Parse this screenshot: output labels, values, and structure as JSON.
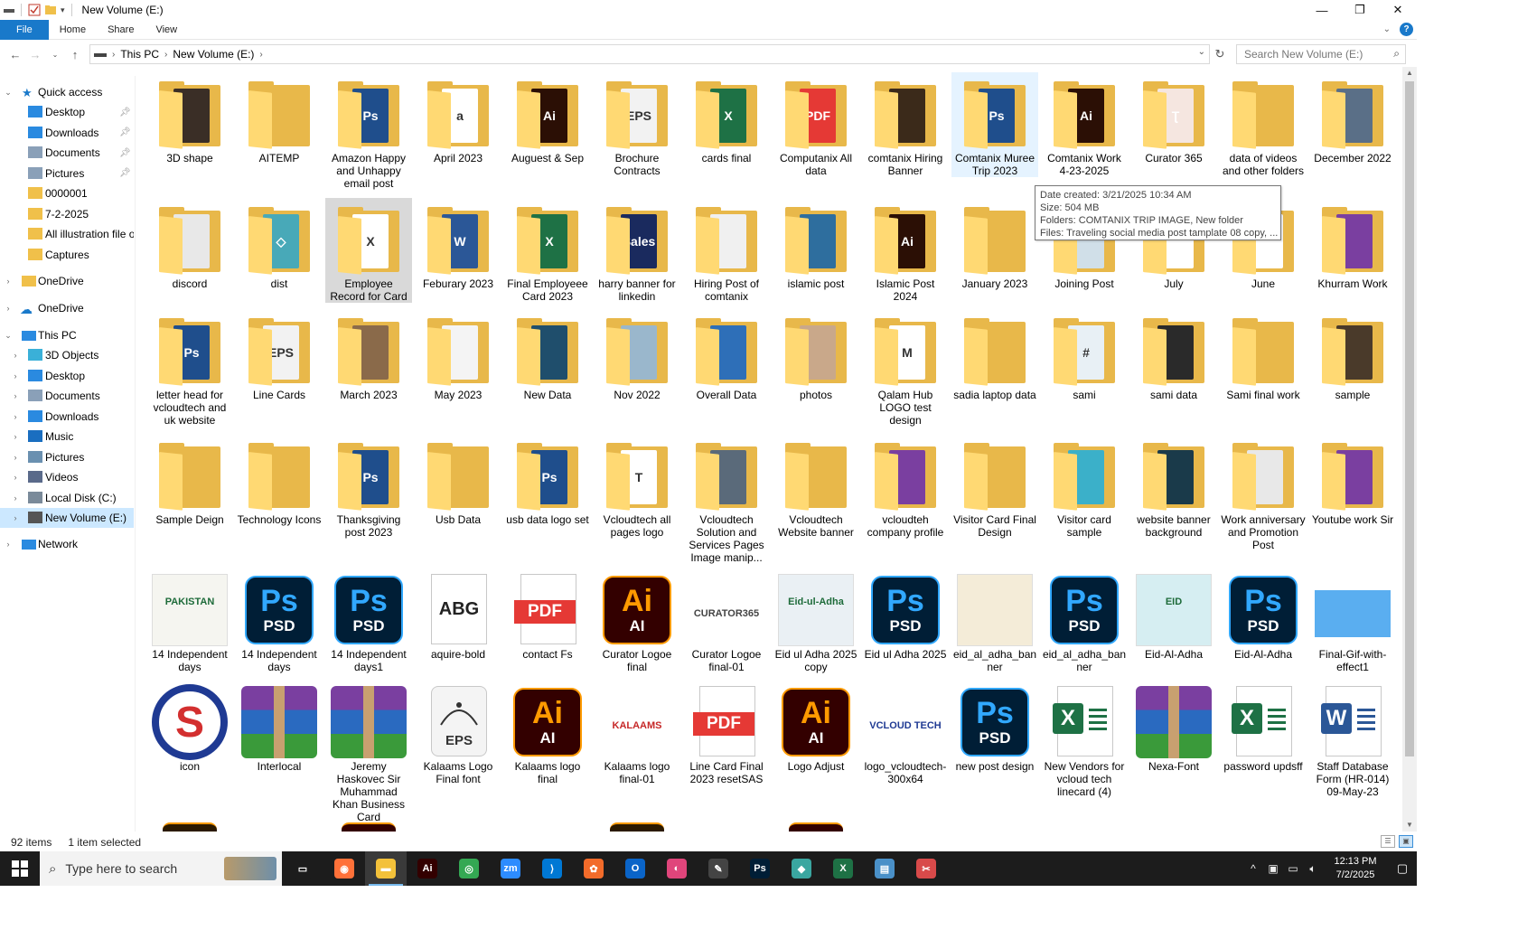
{
  "window": {
    "title": "New Volume (E:)",
    "controls": {
      "minimize": "—",
      "maximize": "❐",
      "close": "✕"
    }
  },
  "ribbon": {
    "tabs": [
      "File",
      "Home",
      "Share",
      "View"
    ],
    "help": "?"
  },
  "address": {
    "crumbs": [
      "This PC",
      "New Volume (E:)"
    ],
    "search_placeholder": "Search New Volume (E:)"
  },
  "sidebar": {
    "quick_access": "Quick access",
    "quick_items": [
      "Desktop",
      "Downloads",
      "Documents",
      "Pictures",
      "0000001",
      "7-2-2025",
      "All illustration file o",
      "Captures"
    ],
    "onedrive1": "OneDrive",
    "onedrive2": "OneDrive",
    "this_pc": "This PC",
    "pc_items": [
      "3D Objects",
      "Desktop",
      "Documents",
      "Downloads",
      "Music",
      "Pictures",
      "Videos",
      "Local Disk (C:)",
      "New Volume (E:)"
    ],
    "network": "Network"
  },
  "items": [
    {
      "label": "3D shape",
      "kind": "folder",
      "paper": "#3a2e26",
      "glyph": ""
    },
    {
      "label": "AITEMP",
      "kind": "folder",
      "paper": "",
      "glyph": ""
    },
    {
      "label": "Amazon Happy and Unhappy email post",
      "kind": "folder",
      "paper": "#1f4e8c",
      "glyph": "Ps"
    },
    {
      "label": "April 2023",
      "kind": "folder",
      "paper": "#ffffff",
      "glyph": "a"
    },
    {
      "label": "Auguest & Sep",
      "kind": "folder",
      "paper": "#2b0f05",
      "glyph": "Ai"
    },
    {
      "label": "Brochure Contracts",
      "kind": "folder",
      "paper": "#f2f2f2",
      "glyph": "EPS"
    },
    {
      "label": "cards final",
      "kind": "folder",
      "paper": "#1e7145",
      "glyph": "X"
    },
    {
      "label": "Computanix All data",
      "kind": "folder",
      "paper": "#e53935",
      "glyph": "PDF"
    },
    {
      "label": "comtanix Hiring Banner",
      "kind": "folder",
      "paper": "#3b2a1a",
      "glyph": ""
    },
    {
      "label": "Comtanix Muree Trip 2023",
      "kind": "folder",
      "paper": "#1f4e8c",
      "glyph": "Ps"
    },
    {
      "label": "Comtanix Work 4-23-2025",
      "kind": "folder",
      "paper": "#2b0f05",
      "glyph": "Ai"
    },
    {
      "label": "Curator 365",
      "kind": "folder",
      "paper": "#f5e6e0",
      "glyph": "Ʈ"
    },
    {
      "label": "data of videos and other folders",
      "kind": "folder",
      "paper": "",
      "glyph": ""
    },
    {
      "label": "December 2022",
      "kind": "folder",
      "paper": "#5a6f87",
      "glyph": ""
    },
    {
      "label": "discord",
      "kind": "folder",
      "paper": "#e8e8e8",
      "glyph": ""
    },
    {
      "label": "dist",
      "kind": "folder",
      "paper": "#48a9b8",
      "glyph": "◇"
    },
    {
      "label": "Employee Record for Card",
      "kind": "folder",
      "paper": "#ffffff",
      "glyph": "X"
    },
    {
      "label": "Feburary 2023",
      "kind": "folder",
      "paper": "#2b5797",
      "glyph": "W"
    },
    {
      "label": "Final  Employeee Card 2023",
      "kind": "folder",
      "paper": "#1e7145",
      "glyph": "X"
    },
    {
      "label": "harry banner for linkedin",
      "kind": "folder",
      "paper": "#1a2a5e",
      "glyph": "Sales"
    },
    {
      "label": "Hiring Post of comtanix",
      "kind": "folder",
      "paper": "#f0f0f0",
      "glyph": ""
    },
    {
      "label": "islamic post",
      "kind": "folder",
      "paper": "#2e6e9e",
      "glyph": ""
    },
    {
      "label": "Islamic Post 2024",
      "kind": "folder",
      "paper": "#2b0f05",
      "glyph": "Ai"
    },
    {
      "label": "January 2023",
      "kind": "folder",
      "paper": "",
      "glyph": ""
    },
    {
      "label": "Joining Post",
      "kind": "folder",
      "paper": "#d0dfe8",
      "glyph": ""
    },
    {
      "label": "July",
      "kind": "folder",
      "paper": "#ffffff",
      "glyph": ""
    },
    {
      "label": "June",
      "kind": "folder",
      "paper": "#ffffff",
      "glyph": ""
    },
    {
      "label": "Khurram Work",
      "kind": "folder",
      "paper": "#7a3fa0",
      "glyph": ""
    },
    {
      "label": "letter head for vcloudtech and uk website",
      "kind": "folder",
      "paper": "#1f4e8c",
      "glyph": "Ps"
    },
    {
      "label": "Line Cards",
      "kind": "folder",
      "paper": "#f2f2f2",
      "glyph": "EPS"
    },
    {
      "label": "March 2023",
      "kind": "folder",
      "paper": "#8a6a4a",
      "glyph": ""
    },
    {
      "label": "May 2023",
      "kind": "folder",
      "paper": "#f4f4f4",
      "glyph": ""
    },
    {
      "label": "New Data",
      "kind": "folder",
      "paper": "#1f4e6c",
      "glyph": ""
    },
    {
      "label": "Nov 2022",
      "kind": "folder",
      "paper": "#9ab7cc",
      "glyph": ""
    },
    {
      "label": "Overall Data",
      "kind": "folder",
      "paper": "#2e6fb8",
      "glyph": ""
    },
    {
      "label": "photos",
      "kind": "folder",
      "paper": "#c9a88a",
      "glyph": ""
    },
    {
      "label": "Qalam Hub LOGO test design",
      "kind": "folder",
      "paper": "#ffffff",
      "glyph": "M"
    },
    {
      "label": "sadia laptop data",
      "kind": "folder",
      "paper": "",
      "glyph": ""
    },
    {
      "label": "sami",
      "kind": "folder",
      "paper": "#e8f0f5",
      "glyph": "#"
    },
    {
      "label": "sami data",
      "kind": "folder",
      "paper": "#2a2a2a",
      "glyph": ""
    },
    {
      "label": "Sami final work",
      "kind": "folder",
      "paper": "",
      "glyph": ""
    },
    {
      "label": "sample",
      "kind": "folder",
      "paper": "#4a3a2a",
      "glyph": ""
    },
    {
      "label": "Sample Deign",
      "kind": "folder",
      "paper": "",
      "glyph": ""
    },
    {
      "label": "Technology Icons",
      "kind": "folder",
      "paper": "",
      "glyph": ""
    },
    {
      "label": "Thanksgiving post 2023",
      "kind": "folder",
      "paper": "#1f4e8c",
      "glyph": "Ps"
    },
    {
      "label": "Usb Data",
      "kind": "folder",
      "paper": "",
      "glyph": ""
    },
    {
      "label": "usb data logo set",
      "kind": "folder",
      "paper": "#1f4e8c",
      "glyph": "Ps"
    },
    {
      "label": "Vcloudtech all pages logo",
      "kind": "folder",
      "paper": "#ffffff",
      "glyph": "T"
    },
    {
      "label": "Vcloudtech Solution and Services Pages Image manip...",
      "kind": "folder",
      "paper": "#5a6a7a",
      "glyph": ""
    },
    {
      "label": "Vcloudtech Website banner",
      "kind": "folder",
      "paper": "",
      "glyph": ""
    },
    {
      "label": "vcloudteh company profile",
      "kind": "folder",
      "paper": "#7a3fa0",
      "glyph": ""
    },
    {
      "label": "Visitor Card Final Design",
      "kind": "folder",
      "paper": "",
      "glyph": ""
    },
    {
      "label": "Visitor card sample",
      "kind": "folder",
      "paper": "#3bb0c9",
      "glyph": ""
    },
    {
      "label": "website banner background",
      "kind": "folder",
      "paper": "#1a3a4a",
      "glyph": ""
    },
    {
      "label": "Work anniversary and Promotion  Post",
      "kind": "folder",
      "paper": "#e8e8e8",
      "glyph": ""
    },
    {
      "label": "Youtube work Sir",
      "kind": "folder",
      "paper": "#7a3fa0",
      "glyph": ""
    },
    {
      "label": "14 Independent days",
      "kind": "image",
      "color": "#f5f5f0",
      "glyph": "PAKISTAN"
    },
    {
      "label": "14 Independent days",
      "kind": "ps",
      "glyph": "Ps",
      "sub": "PSD"
    },
    {
      "label": "14 Independent days1",
      "kind": "ps",
      "glyph": "Ps",
      "sub": "PSD"
    },
    {
      "label": "aquire-bold",
      "kind": "font",
      "glyph": "ABG"
    },
    {
      "label": "contact Fs",
      "kind": "pdf",
      "glyph": "PDF"
    },
    {
      "label": "Curator Logoe final",
      "kind": "ai",
      "glyph": "Ai",
      "sub": "AI"
    },
    {
      "label": "Curator Logoe final-01",
      "kind": "logo",
      "glyph": "CURATOR365",
      "color": "#444444"
    },
    {
      "label": "Eid ul Adha 2025 copy",
      "kind": "image",
      "color": "#eaf0f4",
      "glyph": "Eid-ul-Adha"
    },
    {
      "label": "Eid ul Adha 2025",
      "kind": "ps",
      "glyph": "Ps",
      "sub": "PSD"
    },
    {
      "label": "eid_al_adha_banner",
      "kind": "image",
      "color": "#f4ecd8",
      "glyph": ""
    },
    {
      "label": "eid_al_adha_banner",
      "kind": "ps",
      "glyph": "Ps",
      "sub": "PSD"
    },
    {
      "label": "Eid-Al-Adha",
      "kind": "image",
      "color": "#d6eef2",
      "glyph": "EID"
    },
    {
      "label": "Eid-Al-Adha",
      "kind": "ps",
      "glyph": "Ps",
      "sub": "PSD"
    },
    {
      "label": "Final-Gif-with-effect1",
      "kind": "gif",
      "color": "#5aaef0",
      "glyph": ""
    },
    {
      "label": "icon",
      "kind": "logoS",
      "glyph": "S"
    },
    {
      "label": "Interlocal",
      "kind": "rar",
      "glyph": ""
    },
    {
      "label": "Jeremy Haskovec Sir Muhammad Khan Business Card",
      "kind": "rar",
      "glyph": ""
    },
    {
      "label": "Kalaams Logo Final font",
      "kind": "eps",
      "glyph": "EPS"
    },
    {
      "label": "Kalaams logo final",
      "kind": "ai",
      "glyph": "Ai",
      "sub": "AI"
    },
    {
      "label": "Kalaams logo final-01",
      "kind": "logo",
      "glyph": "KALAAMS",
      "color": "#c62828"
    },
    {
      "label": "Line Card Final 2023 resetSAS",
      "kind": "pdf",
      "glyph": "PDF"
    },
    {
      "label": "Logo Adjust",
      "kind": "ai",
      "glyph": "Ai",
      "sub": "AI"
    },
    {
      "label": "logo_vcloudtech-300x64",
      "kind": "logo",
      "glyph": "VCLOUD TECH",
      "color": "#1f3a93"
    },
    {
      "label": "new post design",
      "kind": "ps",
      "glyph": "Ps",
      "sub": "PSD"
    },
    {
      "label": "New Vendors for vcloud tech linecard (4)",
      "kind": "xls",
      "glyph": "X"
    },
    {
      "label": "Nexa-Font",
      "kind": "rar",
      "glyph": ""
    },
    {
      "label": "password updsff",
      "kind": "xls",
      "glyph": "X"
    },
    {
      "label": "Staff Database Form (HR-014) 09-May-23",
      "kind": "doc",
      "glyph": "W"
    }
  ],
  "tooltip": {
    "lines": [
      "Date created: 3/21/2025 10:34 AM",
      "Size: 504 MB",
      "Folders: COMTANIX TRIP IMAGE, New folder",
      "Files: Traveling social media post tamplate 08 copy, ..."
    ]
  },
  "status": {
    "count": "92 items",
    "selected": "1 item selected"
  },
  "taskbar": {
    "search_placeholder": "Type here to search",
    "time": "12:13 PM",
    "date": "7/2/2025",
    "apps": [
      {
        "name": "task-view",
        "color": "#1c1c1c",
        "glyph": "▭"
      },
      {
        "name": "firefox",
        "color": "#ff7139",
        "glyph": "◉"
      },
      {
        "name": "file-explorer",
        "color": "#f3c13a",
        "glyph": "▬"
      },
      {
        "name": "illustrator",
        "color": "#330000",
        "glyph": "Ai"
      },
      {
        "name": "chrome",
        "color": "#34a853",
        "glyph": "◎"
      },
      {
        "name": "zoom",
        "color": "#2d8cff",
        "glyph": "zm"
      },
      {
        "name": "vscode",
        "color": "#0078d4",
        "glyph": "⟩"
      },
      {
        "name": "app-orange",
        "color": "#f26b2a",
        "glyph": "✿"
      },
      {
        "name": "outlook",
        "color": "#0a64c8",
        "glyph": "O"
      },
      {
        "name": "app-gradient",
        "color": "#e0457b",
        "glyph": "◐"
      },
      {
        "name": "pen-tool",
        "color": "#444444",
        "glyph": "✎"
      },
      {
        "name": "photoshop",
        "color": "#001e36",
        "glyph": "Ps"
      },
      {
        "name": "app-teal",
        "color": "#3aa6a0",
        "glyph": "◆"
      },
      {
        "name": "excel",
        "color": "#1e7145",
        "glyph": "X"
      },
      {
        "name": "app-blue",
        "color": "#4a90c8",
        "glyph": "▤"
      },
      {
        "name": "snipping",
        "color": "#d84a4a",
        "glyph": "✂"
      }
    ]
  },
  "colors": {
    "accent": "#1979ca",
    "hover": "#e5f3ff",
    "selected": "#d9d9d9",
    "nav_selected": "#cce8ff"
  }
}
